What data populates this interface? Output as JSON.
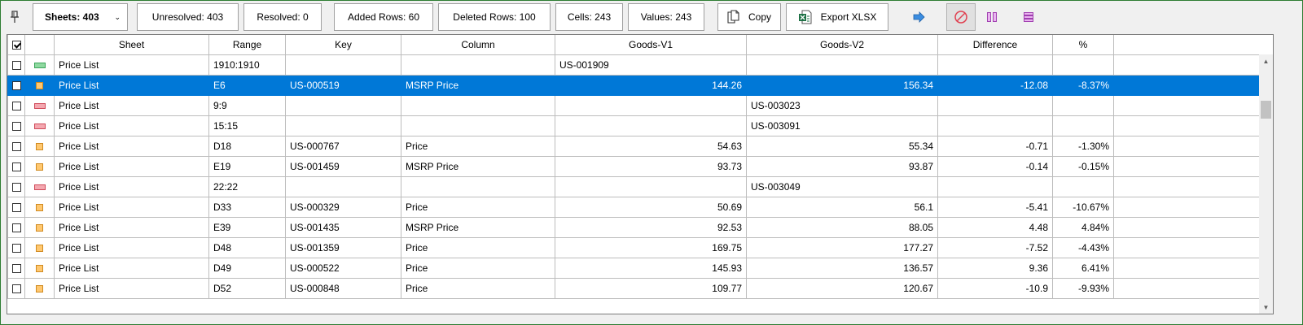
{
  "toolbar": {
    "sheets_label": "Sheets: 403",
    "unresolved_label": "Unresolved: 403",
    "resolved_label": "Resolved: 0",
    "added_rows_label": "Added Rows: 60",
    "deleted_rows_label": "Deleted Rows: 100",
    "cells_label": "Cells: 243",
    "values_label": "Values: 243",
    "copy_label": "Copy",
    "export_label": "Export XLSX",
    "icons": [
      "pin-icon",
      "copy-icon",
      "excel-icon",
      "arrow-right-icon",
      "stop-icon",
      "columns-icon",
      "rows-icon"
    ]
  },
  "colors": {
    "selection": "#0078d7",
    "added": "#8fd9a0",
    "deleted": "#f4a8b0",
    "changed": "#ffc870",
    "frame": "#2e7d32"
  },
  "table": {
    "columns": [
      "Sheet",
      "Range",
      "Key",
      "Column",
      "Goods-V1",
      "Goods-V2",
      "Difference",
      "%"
    ],
    "rows": [
      {
        "type": "added",
        "sheet": "Price List",
        "range": "1910:1910",
        "key": "",
        "column": "",
        "v1": "US-001909",
        "v2": "",
        "diff": "",
        "pct": ""
      },
      {
        "type": "changed",
        "sheet": "Price List",
        "range": "E6",
        "key": "US-000519",
        "column": "MSRP Price",
        "v1": "144.26",
        "v2": "156.34",
        "diff": "-12.08",
        "pct": "-8.37%",
        "selected": true
      },
      {
        "type": "deleted",
        "sheet": "Price List",
        "range": "9:9",
        "key": "",
        "column": "",
        "v1": "",
        "v2": "US-003023",
        "diff": "",
        "pct": ""
      },
      {
        "type": "deleted",
        "sheet": "Price List",
        "range": "15:15",
        "key": "",
        "column": "",
        "v1": "",
        "v2": "US-003091",
        "diff": "",
        "pct": ""
      },
      {
        "type": "changed",
        "sheet": "Price List",
        "range": "D18",
        "key": "US-000767",
        "column": "Price",
        "v1": "54.63",
        "v2": "55.34",
        "diff": "-0.71",
        "pct": "-1.30%"
      },
      {
        "type": "changed",
        "sheet": "Price List",
        "range": "E19",
        "key": "US-001459",
        "column": "MSRP Price",
        "v1": "93.73",
        "v2": "93.87",
        "diff": "-0.14",
        "pct": "-0.15%"
      },
      {
        "type": "deleted",
        "sheet": "Price List",
        "range": "22:22",
        "key": "",
        "column": "",
        "v1": "",
        "v2": "US-003049",
        "diff": "",
        "pct": ""
      },
      {
        "type": "changed",
        "sheet": "Price List",
        "range": "D33",
        "key": "US-000329",
        "column": "Price",
        "v1": "50.69",
        "v2": "56.1",
        "diff": "-5.41",
        "pct": "-10.67%"
      },
      {
        "type": "changed",
        "sheet": "Price List",
        "range": "E39",
        "key": "US-001435",
        "column": "MSRP Price",
        "v1": "92.53",
        "v2": "88.05",
        "diff": "4.48",
        "pct": "4.84%"
      },
      {
        "type": "changed",
        "sheet": "Price List",
        "range": "D48",
        "key": "US-001359",
        "column": "Price",
        "v1": "169.75",
        "v2": "177.27",
        "diff": "-7.52",
        "pct": "-4.43%"
      },
      {
        "type": "changed",
        "sheet": "Price List",
        "range": "D49",
        "key": "US-000522",
        "column": "Price",
        "v1": "145.93",
        "v2": "136.57",
        "diff": "9.36",
        "pct": "6.41%"
      },
      {
        "type": "changed",
        "sheet": "Price List",
        "range": "D52",
        "key": "US-000848",
        "column": "Price",
        "v1": "109.77",
        "v2": "120.67",
        "diff": "-10.9",
        "pct": "-9.93%"
      }
    ]
  }
}
